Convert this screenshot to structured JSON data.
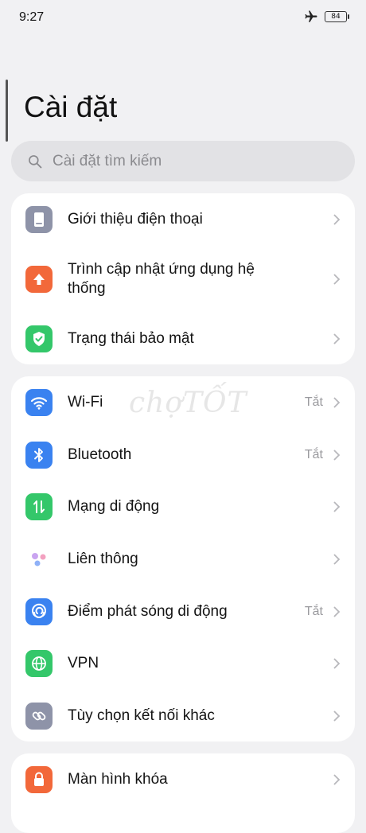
{
  "status": {
    "time": "9:27",
    "battery": "84"
  },
  "page_title": "Cài đặt",
  "search": {
    "placeholder": "Cài đặt tìm kiếm"
  },
  "watermark": "chợTỐT",
  "groups": [
    {
      "items": [
        {
          "label": "Giới thiệu điện thoại",
          "icon": "phone-icon",
          "color": "#8e93a8"
        },
        {
          "label": "Trình cập nhật ứng dụng hệ thống",
          "icon": "update-arrow-icon",
          "color": "#f2683a"
        },
        {
          "label": "Trạng thái bảo mật",
          "icon": "shield-check-icon",
          "color": "#34c76a"
        }
      ]
    },
    {
      "items": [
        {
          "label": "Wi-Fi",
          "value": "Tắt",
          "icon": "wifi-icon",
          "color": "#3a82f0"
        },
        {
          "label": "Bluetooth",
          "value": "Tắt",
          "icon": "bluetooth-icon",
          "color": "#3a82f0"
        },
        {
          "label": "Mạng di động",
          "icon": "mobile-data-icon",
          "color": "#34c76a"
        },
        {
          "label": "Liên thông",
          "icon": "connect-dots-icon",
          "color": "#ffffff"
        },
        {
          "label": "Điểm phát sóng di động",
          "value": "Tắt",
          "icon": "hotspot-icon",
          "color": "#3a82f0"
        },
        {
          "label": "VPN",
          "icon": "globe-icon",
          "color": "#34c76a"
        },
        {
          "label": "Tùy chọn kết nối khác",
          "icon": "link-icon",
          "color": "#8e93a8"
        }
      ]
    },
    {
      "items": [
        {
          "label": "Màn hình khóa",
          "icon": "lock-icon",
          "color": "#f2683a"
        }
      ]
    }
  ]
}
